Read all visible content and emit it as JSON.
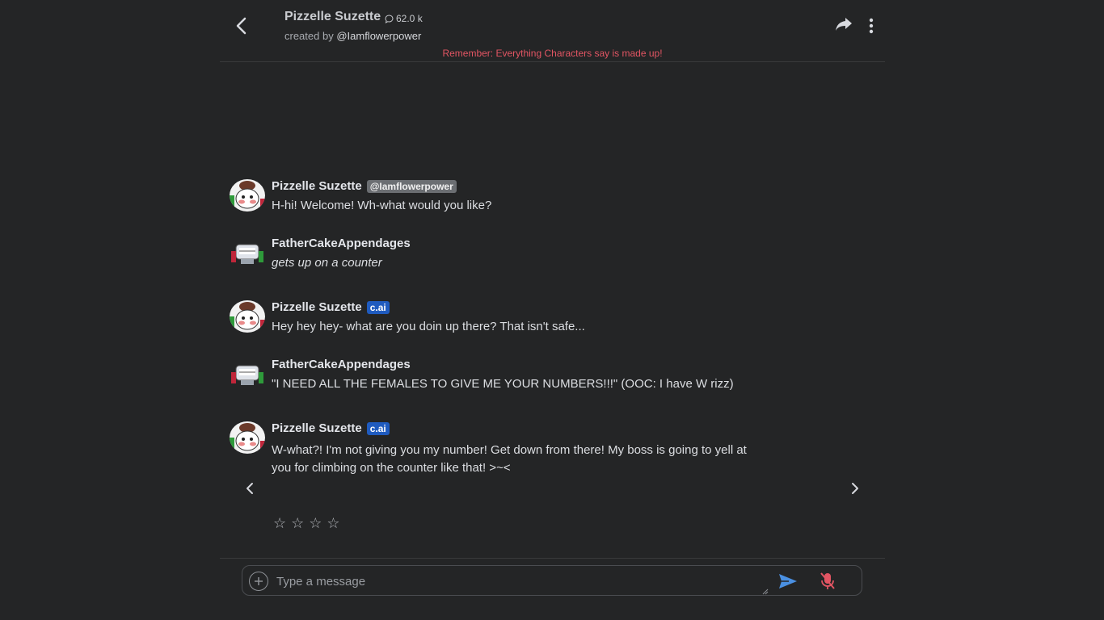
{
  "header": {
    "character_name": "Pizzelle Suzette",
    "chat_count": "62.0 k",
    "created_by_prefix": "created by",
    "creator_handle": "@Iamflowerpower",
    "warning": "Remember: Everything Characters say is made up!"
  },
  "messages": [
    {
      "author": "Pizzelle Suzette",
      "tag": "@Iamflowerpower",
      "text": "H-hi! Welcome! Wh-what would you like?"
    },
    {
      "author": "FatherCakeAppendages",
      "tag": "",
      "text": "gets up on a counter"
    },
    {
      "author": "Pizzelle Suzette",
      "tag": "c.ai",
      "text": "Hey hey hey- what are you doin up there? That isn't safe..."
    },
    {
      "author": "FatherCakeAppendages",
      "tag": "",
      "text": "\"I NEED ALL THE FEMALES TO GIVE ME YOUR NUMBERS!!!\" (OOC: I have W rizz)"
    },
    {
      "author": "Pizzelle Suzette",
      "tag": "c.ai",
      "text": "W-what?! I'm not giving you my number! Get down from there! My boss is going to yell at you for climbing on the counter like that! >~<"
    }
  ],
  "rating": {
    "stars": [
      "☆",
      "☆",
      "☆",
      "☆"
    ]
  },
  "composer": {
    "placeholder": "Type a message"
  },
  "colors": {
    "background": "#242526",
    "accent_tag": "#1f5bbf",
    "warning": "#e25563",
    "send_icon": "#4a90e2",
    "mic_muted": "#e25563"
  },
  "icons": [
    "back-arrow-icon",
    "chat-bubble-icon",
    "share-icon",
    "more-vertical-icon",
    "chevron-left-icon",
    "chevron-right-icon",
    "star-outline-icon",
    "plus-circle-icon",
    "send-icon",
    "mic-off-icon"
  ]
}
